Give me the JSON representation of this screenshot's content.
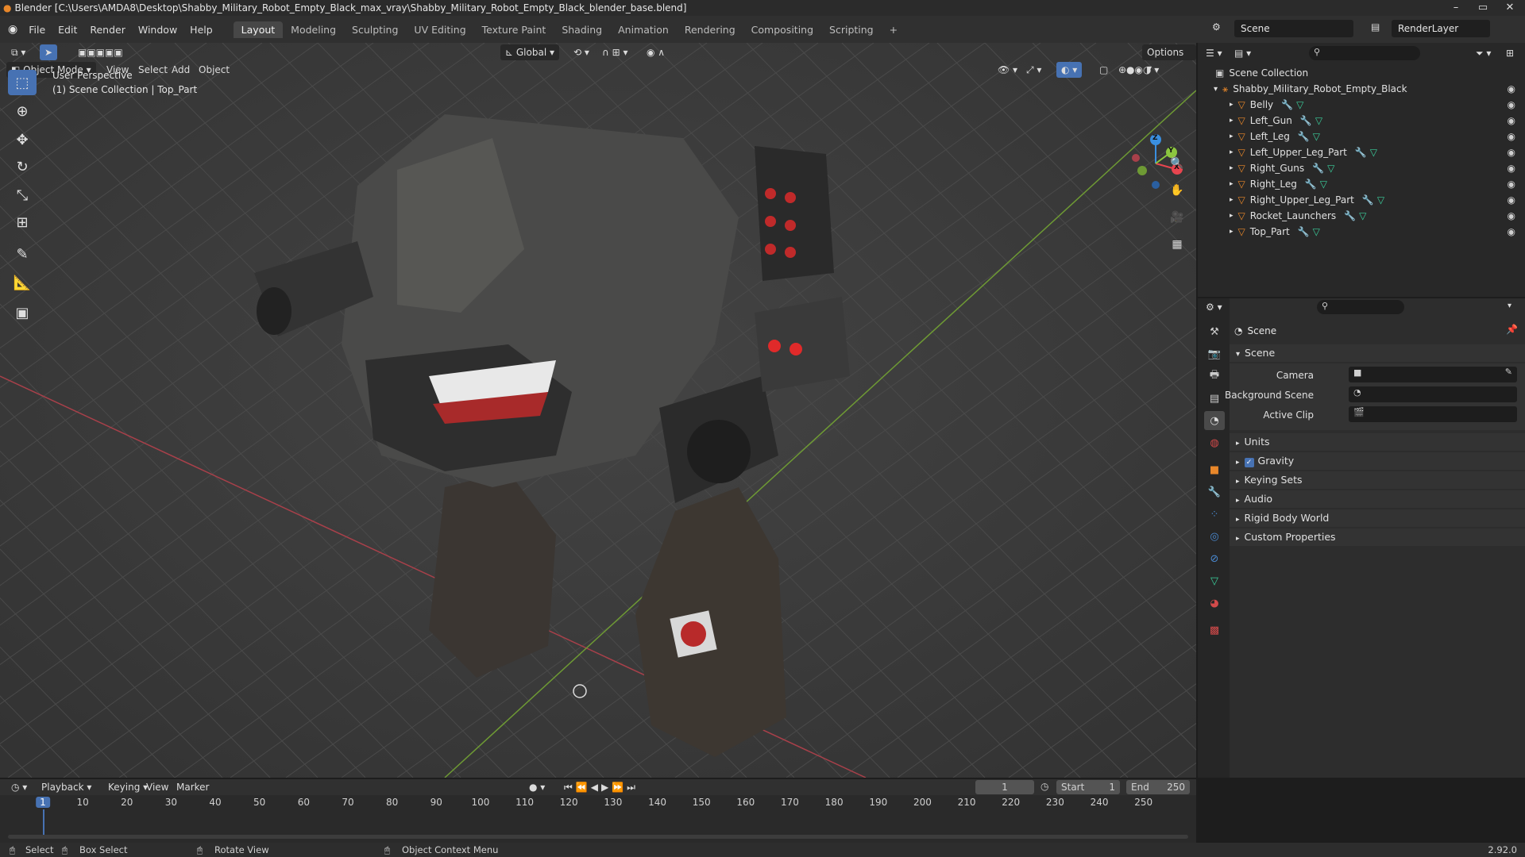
{
  "window": {
    "title": "Blender [C:\\Users\\AMDA8\\Desktop\\Shabby_Military_Robot_Empty_Black_max_vray\\Shabby_Military_Robot_Empty_Black_blender_base.blend]"
  },
  "menu": [
    "File",
    "Edit",
    "Render",
    "Window",
    "Help"
  ],
  "workspaces": [
    "Layout",
    "Modeling",
    "Sculpting",
    "UV Editing",
    "Texture Paint",
    "Shading",
    "Animation",
    "Rendering",
    "Compositing",
    "Scripting"
  ],
  "workspace_add": "+",
  "scene_name": "Scene",
  "view_layer": "RenderLayer",
  "viewport": {
    "mode": "Object Mode",
    "menus": [
      "View",
      "Select",
      "Add",
      "Object"
    ],
    "orientation": "Global",
    "options": "Options",
    "perspective_label": "User Perspective",
    "collection_label": "(1) Scene Collection | Top_Part",
    "gizmo": {
      "x": "X",
      "y": "Y",
      "z": "Z"
    }
  },
  "outliner": {
    "root": "Scene Collection",
    "collection": "Shabby_Military_Robot_Empty_Black",
    "objects": [
      "Belly",
      "Left_Gun",
      "Left_Leg",
      "Left_Upper_Leg_Part",
      "Right_Guns",
      "Right_Leg",
      "Right_Upper_Leg_Part",
      "Rocket_Launchers",
      "Top_Part"
    ]
  },
  "properties": {
    "context": "Scene",
    "panel": "Scene",
    "fields": [
      {
        "label": "Camera"
      },
      {
        "label": "Background Scene"
      },
      {
        "label": "Active Clip"
      }
    ],
    "sections": [
      "Units",
      "Gravity",
      "Keying Sets",
      "Audio",
      "Rigid Body World",
      "Custom Properties"
    ],
    "gravity_checked": true
  },
  "timeline": {
    "menus": [
      "Playback",
      "Keying",
      "View",
      "Marker"
    ],
    "current_frame": "1",
    "start_label": "Start",
    "start": "1",
    "end_label": "End",
    "end": "250",
    "ticks": [
      "1",
      "10",
      "20",
      "30",
      "40",
      "50",
      "60",
      "70",
      "80",
      "90",
      "100",
      "110",
      "120",
      "130",
      "140",
      "150",
      "160",
      "170",
      "180",
      "190",
      "200",
      "210",
      "220",
      "230",
      "240",
      "250"
    ]
  },
  "status": {
    "select": "Select",
    "box_select": "Box Select",
    "rotate_view": "Rotate View",
    "context_menu": "Object Context Menu",
    "version": "2.92.0"
  },
  "colors": {
    "accent": "#4772b3",
    "object_icon": "#e8872a",
    "mesh_icon": "#3bd09d",
    "x_axis": "#e8454f",
    "y_axis": "#8cc63f",
    "z_axis": "#3a8fe0"
  }
}
